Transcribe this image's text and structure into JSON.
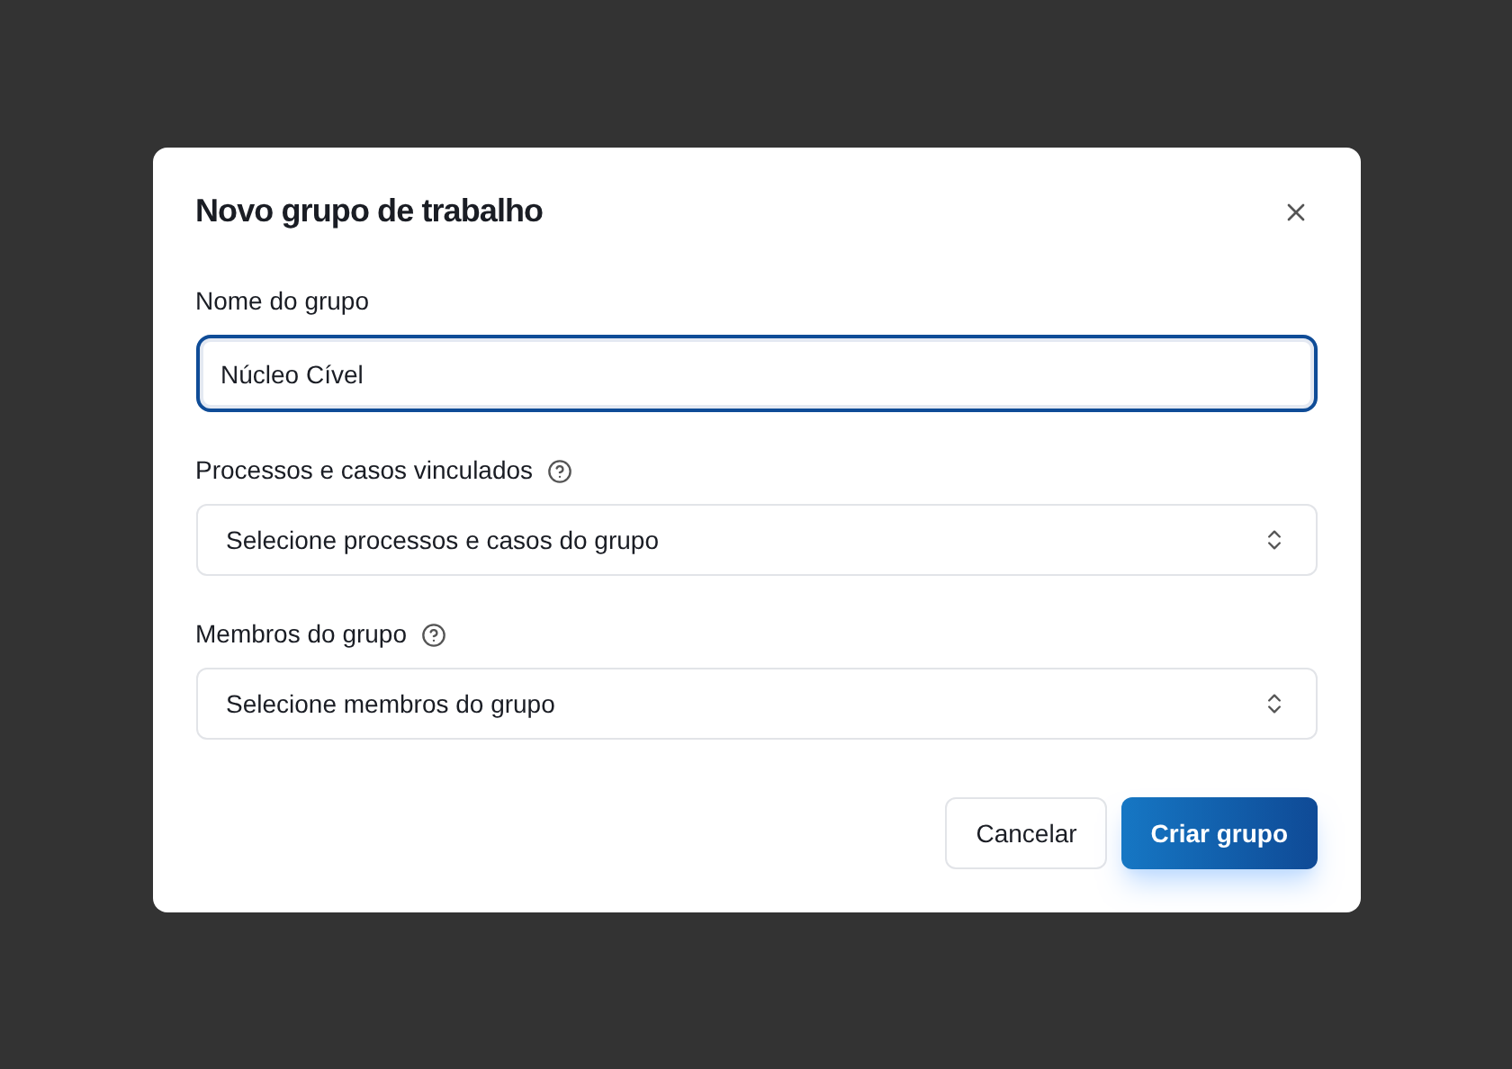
{
  "dialog": {
    "title": "Novo grupo de trabalho"
  },
  "fields": [
    {
      "kind": "text",
      "label": "Nome do grupo",
      "help": false,
      "value": "Núcleo Cível",
      "focused": true
    },
    {
      "kind": "select",
      "label": "Processos e casos vinculados",
      "help": true,
      "value": "Selecione processos e casos do grupo",
      "focused": false
    },
    {
      "kind": "select",
      "label": "Membros do grupo",
      "help": true,
      "value": "Selecione membros do grupo",
      "focused": false
    }
  ],
  "buttons": [
    {
      "kind": "secondary",
      "label": "Cancelar"
    },
    {
      "kind": "primary",
      "label": "Criar grupo"
    }
  ]
}
